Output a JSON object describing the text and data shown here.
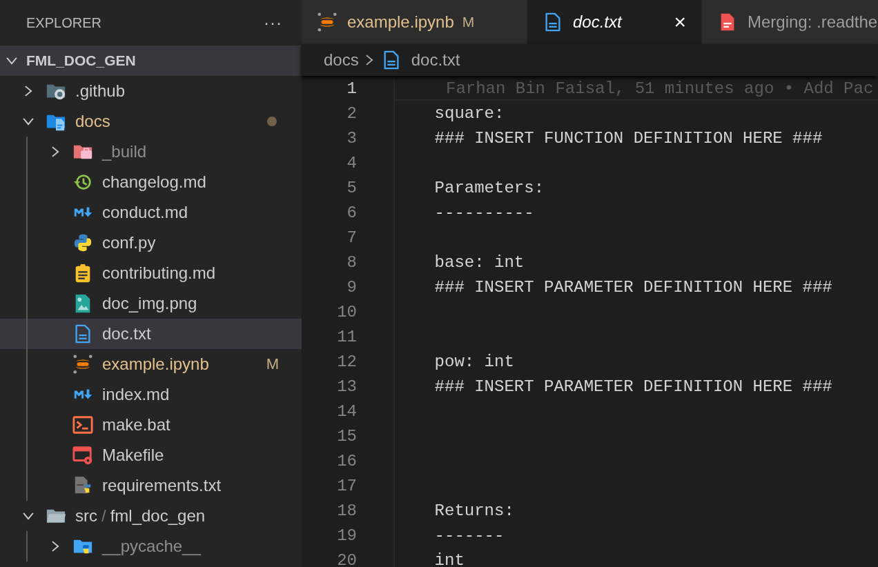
{
  "sidebar": {
    "title": "EXPLORER",
    "more": "···",
    "root": {
      "label": "FML_DOC_GEN",
      "expanded": true,
      "children": [
        {
          "label": ".github",
          "kind": "githubfolder",
          "expanded": false,
          "selected": false,
          "modified": false,
          "ignored": false
        },
        {
          "label": "docs",
          "kind": "docsfolder",
          "expanded": true,
          "selected": false,
          "modified": true,
          "ignored": false,
          "dot": true,
          "children": [
            {
              "label": "_build",
              "kind": "buildfolder",
              "expanded": false,
              "selected": false,
              "modified": false,
              "ignored": true
            },
            {
              "label": "changelog.md",
              "kind": "history",
              "selected": false,
              "modified": false,
              "ignored": false
            },
            {
              "label": "conduct.md",
              "kind": "markdown",
              "selected": false,
              "modified": false,
              "ignored": false
            },
            {
              "label": "conf.py",
              "kind": "python",
              "selected": false,
              "modified": false,
              "ignored": false
            },
            {
              "label": "contributing.md",
              "kind": "clipboard",
              "selected": false,
              "modified": false,
              "ignored": false
            },
            {
              "label": "doc_img.png",
              "kind": "image",
              "selected": false,
              "modified": false,
              "ignored": false
            },
            {
              "label": "doc.txt",
              "kind": "text",
              "selected": true,
              "modified": false,
              "ignored": false
            },
            {
              "label": "example.ipynb",
              "kind": "notebook",
              "selected": false,
              "modified": true,
              "ignored": false,
              "badge": "M"
            },
            {
              "label": "index.md",
              "kind": "markdown",
              "selected": false,
              "modified": false,
              "ignored": false
            },
            {
              "label": "make.bat",
              "kind": "terminal",
              "selected": false,
              "modified": false,
              "ignored": false
            },
            {
              "label": "Makefile",
              "kind": "makefile",
              "selected": false,
              "modified": false,
              "ignored": false
            },
            {
              "label": "requirements.txt",
              "kind": "requirements",
              "selected": false,
              "modified": false,
              "ignored": false
            }
          ]
        },
        {
          "label": "src",
          "label_2": "fml_doc_gen",
          "separator": "/",
          "kind": "folder",
          "expanded": true,
          "selected": false,
          "modified": false,
          "ignored": false,
          "children": [
            {
              "label": "__pycache__",
              "kind": "pythonfolder",
              "expanded": false,
              "selected": false,
              "modified": false,
              "ignored": true
            }
          ]
        }
      ]
    }
  },
  "tabs": [
    {
      "label": "example.ipynb",
      "kind": "notebook",
      "selected": false,
      "modified": true,
      "badge": "M",
      "preview": false
    },
    {
      "label": "doc.txt",
      "kind": "text",
      "selected": true,
      "modified": false,
      "preview": true,
      "close": "×"
    },
    {
      "label": "Merging: .readthe",
      "kind": "merge",
      "selected": false,
      "modified": false,
      "preview": false
    }
  ],
  "breadcrumb": [
    {
      "label": "docs",
      "kind": "folder"
    },
    {
      "label": "doc.txt",
      "kind": "text"
    }
  ],
  "editor": {
    "lines": [
      {
        "number": "1",
        "active": true,
        "blame": "Farhan Bin Faisal, 51 minutes ago • Add Pac"
      },
      {
        "number": "2",
        "text": "    square:",
        "active": false
      },
      {
        "number": "3",
        "text": "    ### INSERT FUNCTION DEFINITION HERE ###",
        "active": false
      },
      {
        "number": "4",
        "active": false
      },
      {
        "number": "5",
        "text": "    Parameters:",
        "active": false
      },
      {
        "number": "6",
        "text": "    ----------",
        "active": false
      },
      {
        "number": "7",
        "active": false
      },
      {
        "number": "8",
        "text": "    base: int",
        "active": false
      },
      {
        "number": "9",
        "text": "    ### INSERT PARAMETER DEFINITION HERE ###",
        "active": false
      },
      {
        "number": "10",
        "active": false
      },
      {
        "number": "11",
        "active": false
      },
      {
        "number": "12",
        "text": "    pow: int",
        "active": false
      },
      {
        "number": "13",
        "text": "    ### INSERT PARAMETER DEFINITION HERE ###",
        "active": false
      },
      {
        "number": "14",
        "active": false
      },
      {
        "number": "15",
        "active": false
      },
      {
        "number": "16",
        "active": false
      },
      {
        "number": "17",
        "active": false
      },
      {
        "number": "18",
        "text": "    Returns:",
        "active": false
      },
      {
        "number": "19",
        "text": "    -------",
        "active": false
      },
      {
        "number": "20",
        "text": "    int",
        "active": false
      }
    ]
  }
}
